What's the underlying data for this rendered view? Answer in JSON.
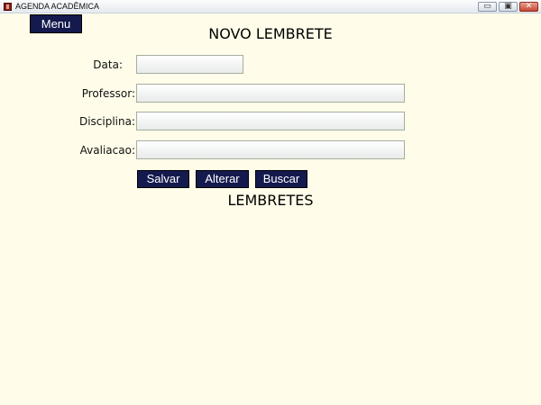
{
  "window": {
    "title": "AGENDA ACADÊMICA",
    "minimize_label": "▭",
    "restore_label": "▣",
    "close_label": "✕"
  },
  "menu": {
    "label": "Menu"
  },
  "form": {
    "heading": "NOVO LEMBRETE",
    "fields": [
      {
        "label": "Data:",
        "value": ""
      },
      {
        "label": "Professor:",
        "value": ""
      },
      {
        "label": "Disciplina:",
        "value": ""
      },
      {
        "label": "Avaliacao:",
        "value": ""
      }
    ],
    "buttons": {
      "save": "Salvar",
      "edit": "Alterar",
      "search": "Buscar"
    }
  },
  "reminders": {
    "heading": "LEMBRETES"
  }
}
